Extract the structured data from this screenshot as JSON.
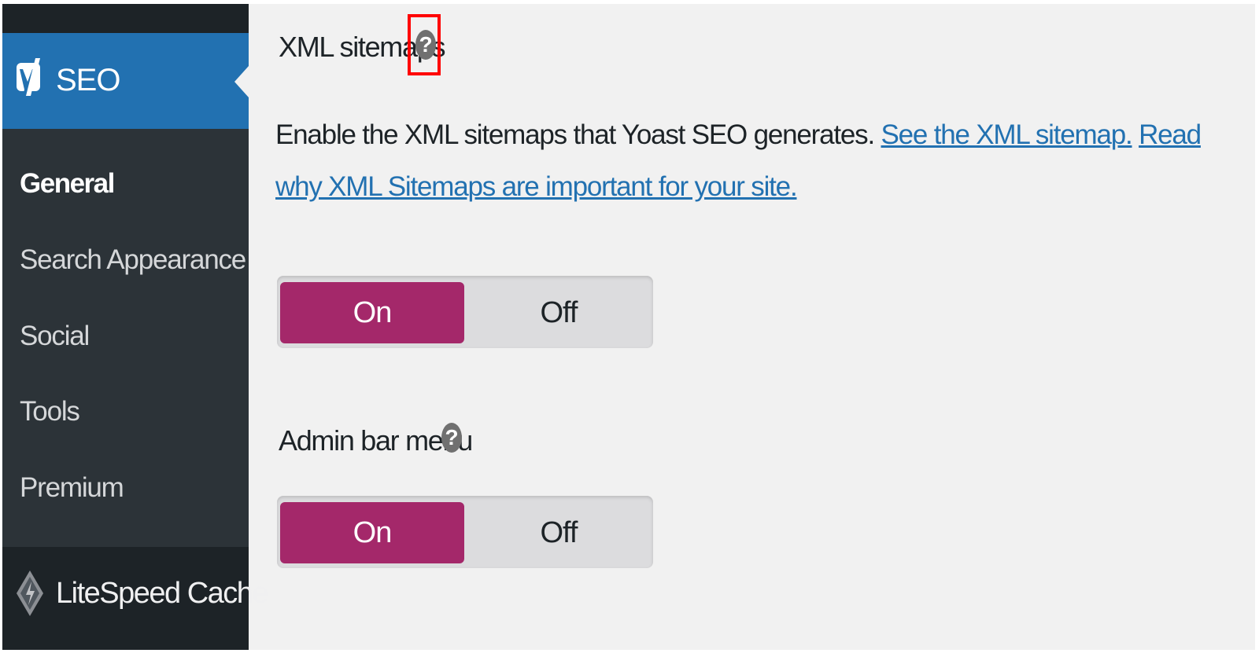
{
  "sidebar": {
    "seo_label": "SEO",
    "items": [
      {
        "label": "General",
        "active": true
      },
      {
        "label": "Search Appearance",
        "active": false
      },
      {
        "label": "Social",
        "active": false
      },
      {
        "label": "Tools",
        "active": false
      },
      {
        "label": "Premium",
        "active": false
      }
    ],
    "litespeed_label": "LiteSpeed Cache"
  },
  "main": {
    "xml_sitemaps": {
      "label": "XML sitemaps",
      "help": "?",
      "description": "Enable the XML sitemaps that Yoast SEO generates.",
      "link1": "See the XML sitemap.",
      "link2": "Read why XML Sitemaps are important for your site.",
      "toggle": {
        "on": "On",
        "off": "Off",
        "selected": "On"
      }
    },
    "admin_bar_menu": {
      "label": "Admin bar menu",
      "help": "?",
      "toggle": {
        "on": "On",
        "off": "Off",
        "selected": "On"
      }
    }
  },
  "colors": {
    "sidebar_bg": "#2c3338",
    "seo_active_bg": "#2271b1",
    "toggle_on_bg": "#a4286a",
    "link": "#2271b1",
    "highlight": "#ff0000"
  }
}
